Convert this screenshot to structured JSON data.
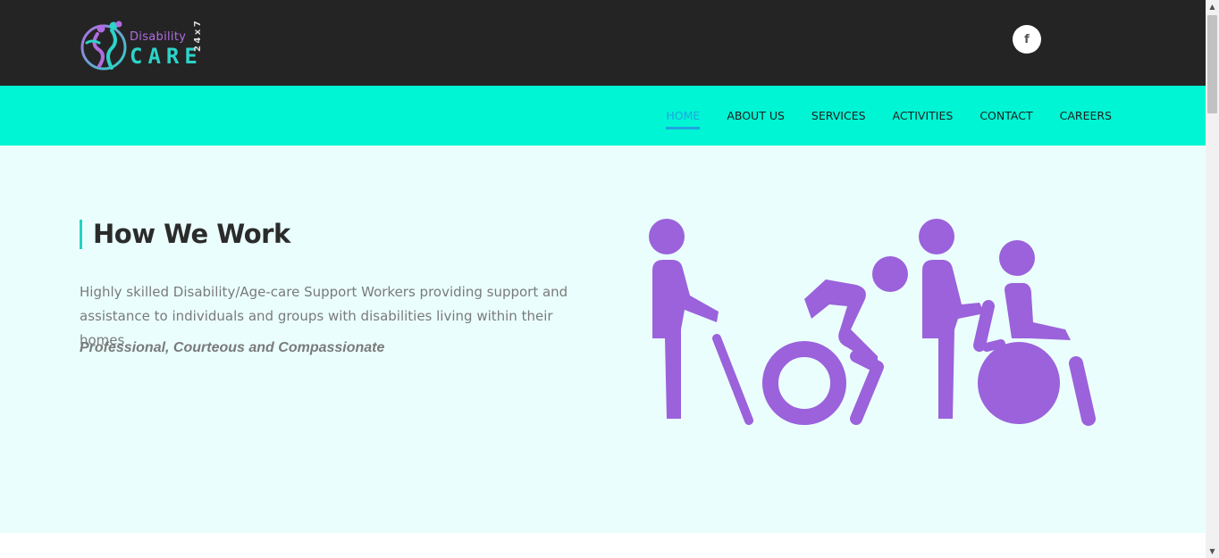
{
  "header": {
    "logo": {
      "word1": "Disability",
      "word2": "CARE",
      "badge": "24x7"
    },
    "social": {
      "facebook_icon": "f"
    }
  },
  "nav": {
    "items": [
      {
        "label": "HOME",
        "active": true
      },
      {
        "label": "ABOUT US",
        "active": false
      },
      {
        "label": "SERVICES",
        "active": false
      },
      {
        "label": "ACTIVITIES",
        "active": false
      },
      {
        "label": "CONTACT",
        "active": false
      },
      {
        "label": "CAREERS",
        "active": false
      }
    ]
  },
  "hero": {
    "heading": "How We Work",
    "description": "Highly skilled Disability/Age-care Support Workers providing support and assistance to individuals and groups with disabilities living within their homes",
    "tagline": "Professional, Courteous and Compassionate",
    "illustration_icon": "disability-support-figures-icon"
  },
  "colors": {
    "topbar": "#242424",
    "nav_background": "#00f5d4",
    "nav_active": "#1ea7e0",
    "hero_background": "#eafffd",
    "accent_teal": "#22d3c4",
    "figure_purple": "#9b62db",
    "logo_purple": "#b06ce0",
    "logo_teal": "#2dd3c8"
  }
}
